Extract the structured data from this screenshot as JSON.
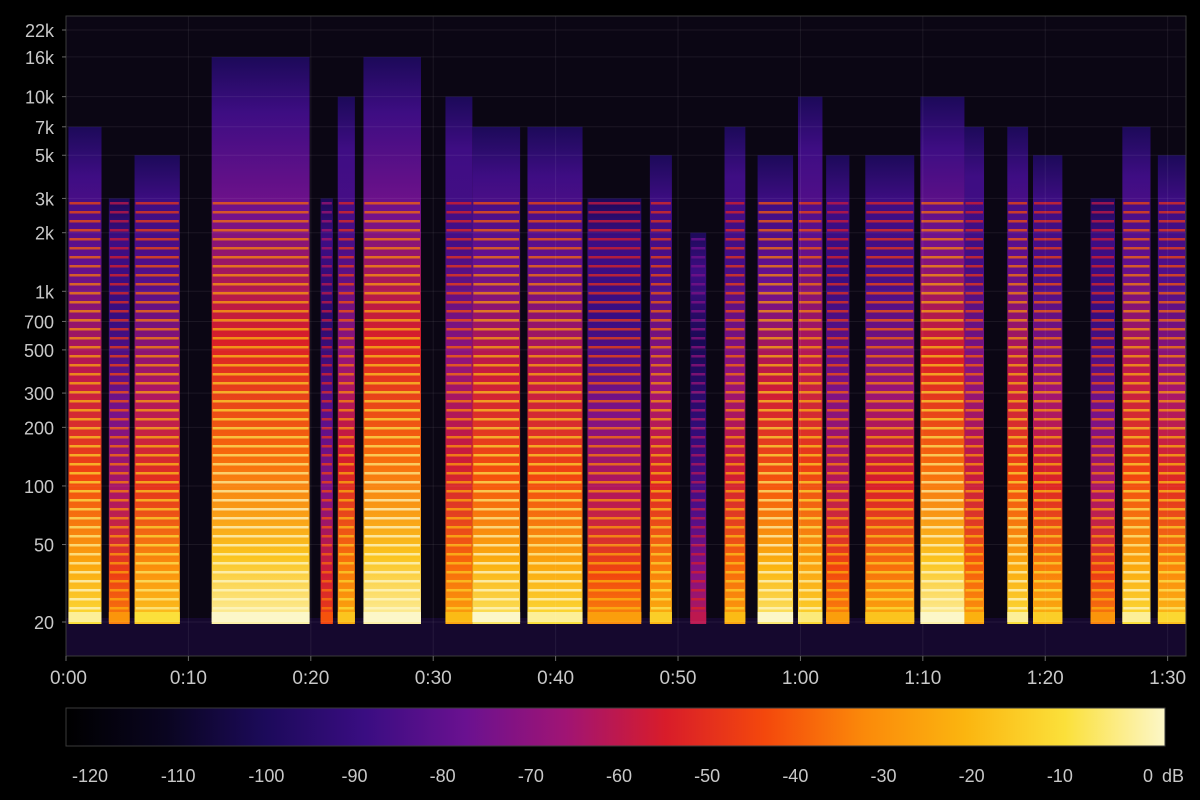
{
  "chart_data": {
    "type": "heatmap",
    "title": "",
    "xlabel": "",
    "ylabel": "",
    "y_scale": "log",
    "grid": true,
    "x_ticks": [
      {
        "label": "0:00",
        "value": 0
      },
      {
        "label": "0:10",
        "value": 10
      },
      {
        "label": "0:20",
        "value": 20
      },
      {
        "label": "0:30",
        "value": 30
      },
      {
        "label": "0:40",
        "value": 40
      },
      {
        "label": "0:50",
        "value": 50
      },
      {
        "label": "1:00",
        "value": 60
      },
      {
        "label": "1:10",
        "value": 70
      },
      {
        "label": "1:20",
        "value": 80
      },
      {
        "label": "1:30",
        "value": 90
      }
    ],
    "xlim": [
      0,
      91.5
    ],
    "y_ticks": [
      {
        "label": "22k",
        "value": 22000
      },
      {
        "label": "16k",
        "value": 16000
      },
      {
        "label": "10k",
        "value": 10000
      },
      {
        "label": "7k",
        "value": 7000
      },
      {
        "label": "5k",
        "value": 5000
      },
      {
        "label": "3k",
        "value": 3000
      },
      {
        "label": "2k",
        "value": 2000
      },
      {
        "label": "1k",
        "value": 1000
      },
      {
        "label": "700",
        "value": 700
      },
      {
        "label": "500",
        "value": 500
      },
      {
        "label": "300",
        "value": 300
      },
      {
        "label": "200",
        "value": 200
      },
      {
        "label": "100",
        "value": 100
      },
      {
        "label": "50",
        "value": 50
      },
      {
        "label": "20",
        "value": 20
      }
    ],
    "colorbar": {
      "ticks": [
        "-120",
        "-110",
        "-100",
        "-90",
        "-80",
        "-70",
        "-60",
        "-50",
        "-40",
        "-30",
        "-20",
        "-10",
        "0"
      ],
      "range": [
        -120,
        0
      ],
      "unit": "dB",
      "colormap": [
        "#000000",
        "#0a0520",
        "#1c0a5a",
        "#3a0d82",
        "#6a1190",
        "#a01474",
        "#d81c2a",
        "#f4480c",
        "#fb8a0a",
        "#fbb50f",
        "#fbe03a",
        "#fcf7c8"
      ]
    },
    "segments": [
      {
        "start": 0.2,
        "end": 2.9,
        "intensity": 0.92,
        "top_freq": 7000
      },
      {
        "start": 3.5,
        "end": 5.2,
        "intensity": 0.7,
        "top_freq": 3000
      },
      {
        "start": 5.6,
        "end": 9.3,
        "intensity": 0.86,
        "top_freq": 5000
      },
      {
        "start": 11.9,
        "end": 19.9,
        "intensity": 1.0,
        "top_freq": 16000
      },
      {
        "start": 20.8,
        "end": 21.8,
        "intensity": 0.6,
        "top_freq": 3000
      },
      {
        "start": 22.2,
        "end": 23.6,
        "intensity": 0.8,
        "top_freq": 10000
      },
      {
        "start": 24.3,
        "end": 29.0,
        "intensity": 1.0,
        "top_freq": 16000
      },
      {
        "start": 31.0,
        "end": 33.2,
        "intensity": 0.78,
        "top_freq": 10000
      },
      {
        "start": 33.2,
        "end": 37.1,
        "intensity": 0.95,
        "top_freq": 7000
      },
      {
        "start": 37.7,
        "end": 42.2,
        "intensity": 0.92,
        "top_freq": 7000
      },
      {
        "start": 42.6,
        "end": 47.0,
        "intensity": 0.72,
        "top_freq": 3000
      },
      {
        "start": 47.7,
        "end": 49.5,
        "intensity": 0.82,
        "top_freq": 5000
      },
      {
        "start": 51.0,
        "end": 52.3,
        "intensity": 0.45,
        "top_freq": 2000
      },
      {
        "start": 53.8,
        "end": 55.5,
        "intensity": 0.78,
        "top_freq": 7000
      },
      {
        "start": 56.5,
        "end": 59.4,
        "intensity": 0.96,
        "top_freq": 5000
      },
      {
        "start": 59.8,
        "end": 61.8,
        "intensity": 0.9,
        "top_freq": 10000
      },
      {
        "start": 62.1,
        "end": 64.0,
        "intensity": 0.72,
        "top_freq": 5000
      },
      {
        "start": 65.3,
        "end": 69.3,
        "intensity": 0.8,
        "top_freq": 5000
      },
      {
        "start": 69.8,
        "end": 73.4,
        "intensity": 1.0,
        "top_freq": 10000
      },
      {
        "start": 73.4,
        "end": 75.0,
        "intensity": 0.76,
        "top_freq": 7000
      },
      {
        "start": 76.9,
        "end": 78.6,
        "intensity": 0.92,
        "top_freq": 7000
      },
      {
        "start": 79.0,
        "end": 81.4,
        "intensity": 0.82,
        "top_freq": 5000
      },
      {
        "start": 83.7,
        "end": 85.7,
        "intensity": 0.7,
        "top_freq": 3000
      },
      {
        "start": 86.3,
        "end": 88.6,
        "intensity": 0.92,
        "top_freq": 7000
      },
      {
        "start": 89.2,
        "end": 91.5,
        "intensity": 0.84,
        "top_freq": 5000
      }
    ]
  }
}
